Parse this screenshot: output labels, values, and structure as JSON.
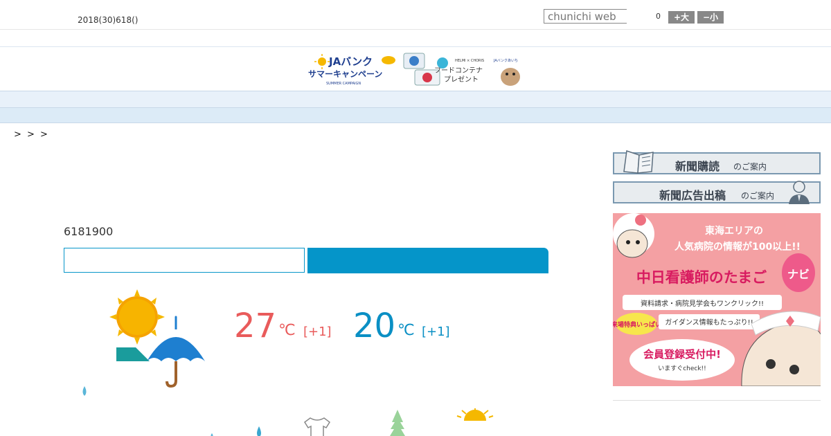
{
  "header": {
    "date": "2018(30)618()",
    "search_placeholder": "chunichi web",
    "font_count": "0",
    "font_up_label": "+大",
    "font_down_label": "−小"
  },
  "banner": {
    "line1": "JAバンク",
    "line2": "サマーキャンペーン",
    "line3": "フードコンテナ",
    "line4": "プレゼント",
    "brand": "HELMI × CHORIS"
  },
  "nav": {
    "items": [
      "　　",
      "　　",
      "　　",
      "　　",
      "　　",
      "　　",
      "　　",
      "　　",
      "　　"
    ]
  },
  "breadcrumb": "> > >",
  "forecast": {
    "title": "6181900",
    "high": {
      "value": "27",
      "unit": "℃",
      "diff": "[+1]"
    },
    "low": {
      "value": "20",
      "unit": "℃",
      "diff": "[+1]"
    }
  },
  "sidebar": {
    "subscribe": {
      "big": "新聞購読",
      "small": "のご案内"
    },
    "advertise": {
      "big": "新聞広告出稿",
      "small": "のご案内"
    },
    "ad": {
      "line1": "東海エリアの",
      "line2": "人気病院の情報が100以上!!",
      "line3": "中日看護師のたまご",
      "badge": "ナビ",
      "line4": "資料請求・病院見学会もワンクリック!!",
      "tag": "来場特典いっぱい",
      "line5": "ガイダンス情報もたっぷり!!",
      "line6": "会員登録受付中!",
      "line7": "いますぐcheck!!"
    }
  },
  "colors": {
    "accent": "#0595c9",
    "high": "#e95b5b",
    "low": "#0a8fc4",
    "nav_bg": "#e8f1fa"
  }
}
